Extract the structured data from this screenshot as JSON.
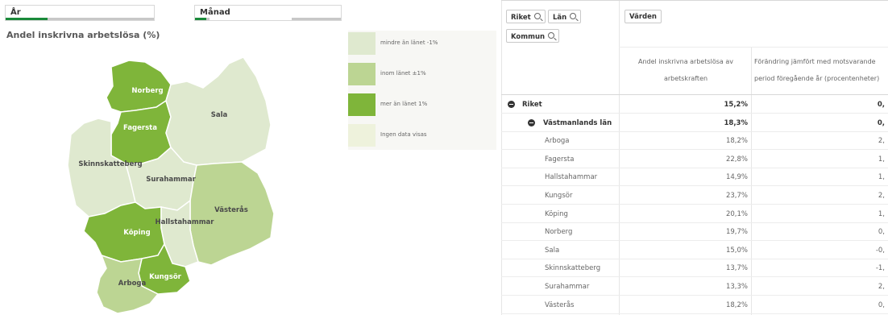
{
  "filters": {
    "year": {
      "label": "År",
      "selected_fraction": 0.28
    },
    "month": {
      "label": "Månad",
      "selected_fraction": 0.08
    }
  },
  "map": {
    "title": "Andel inskrivna arbetslösa (%)",
    "municipalities": [
      {
        "name": "Norberg",
        "category": "more"
      },
      {
        "name": "Fagersta",
        "category": "more"
      },
      {
        "name": "Sala",
        "category": "less"
      },
      {
        "name": "Skinnskatteberg",
        "category": "less"
      },
      {
        "name": "Surahammar",
        "category": "less"
      },
      {
        "name": "Västerås",
        "category": "within"
      },
      {
        "name": "Köping",
        "category": "more"
      },
      {
        "name": "Hallstahammar",
        "category": "less"
      },
      {
        "name": "Kungsör",
        "category": "more"
      },
      {
        "name": "Arboga",
        "category": "within"
      }
    ]
  },
  "legend": [
    {
      "label": "mindre än länet -1%",
      "color": "#dfe9cf"
    },
    {
      "label": "inom länet ±1%",
      "color": "#bcd593"
    },
    {
      "label": "mer än länet 1%",
      "color": "#7fb53a"
    },
    {
      "label": "Ingen data visas",
      "color": "#eef2dc"
    }
  ],
  "colors": {
    "less": "#dfe9cf",
    "within": "#bcd593",
    "more": "#7fb53a",
    "accent": "#1a8a3a"
  },
  "table": {
    "dimension_buttons": [
      {
        "label": "Riket",
        "icon": "search-icon"
      },
      {
        "label": "Län",
        "icon": "search-icon"
      },
      {
        "label": "Kommun",
        "icon": "search-icon"
      }
    ],
    "values_button": "Värden",
    "col1_header_line1": "Andel inskrivna arbetslösa av",
    "col1_header_line2": "arbetskraften",
    "col2_header_line1": "Förändring jämfört med motsvarande",
    "col2_header_line2": "period föregående år (procentenheter)",
    "rows": [
      {
        "label": "Riket",
        "value": "15,2%",
        "change": "0,",
        "level": 0,
        "bold": true
      },
      {
        "label": "Västmanlands län",
        "value": "18,3%",
        "change": "0,",
        "level": 1,
        "bold": true
      },
      {
        "label": "Arboga",
        "value": "18,2%",
        "change": "2,",
        "level": 2,
        "bold": false
      },
      {
        "label": "Fagersta",
        "value": "22,8%",
        "change": "1,",
        "level": 2,
        "bold": false
      },
      {
        "label": "Hallstahammar",
        "value": "14,9%",
        "change": "1,",
        "level": 2,
        "bold": false
      },
      {
        "label": "Kungsör",
        "value": "23,7%",
        "change": "2,",
        "level": 2,
        "bold": false
      },
      {
        "label": "Köping",
        "value": "20,1%",
        "change": "1,",
        "level": 2,
        "bold": false
      },
      {
        "label": "Norberg",
        "value": "19,7%",
        "change": "0,",
        "level": 2,
        "bold": false
      },
      {
        "label": "Sala",
        "value": "15,0%",
        "change": "-0,",
        "level": 2,
        "bold": false
      },
      {
        "label": "Skinnskatteberg",
        "value": "13,7%",
        "change": "-1,",
        "level": 2,
        "bold": false
      },
      {
        "label": "Surahammar",
        "value": "13,3%",
        "change": "2,",
        "level": 2,
        "bold": false
      },
      {
        "label": "Västerås",
        "value": "18,2%",
        "change": "0,",
        "level": 2,
        "bold": false
      }
    ]
  }
}
